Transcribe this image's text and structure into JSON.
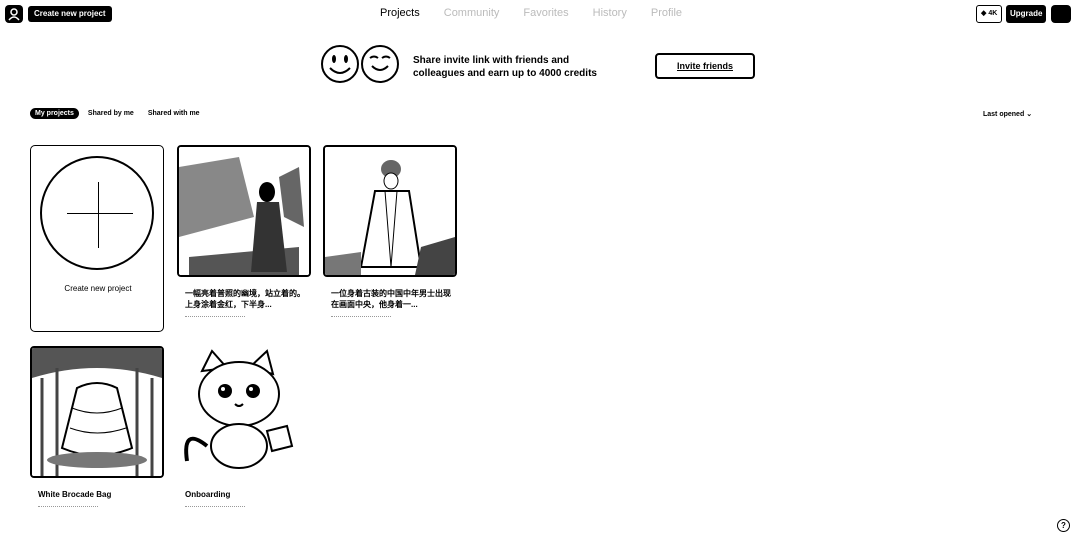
{
  "topbar": {
    "create_label": "Create new project",
    "nav": [
      {
        "label": "Projects",
        "active": true
      },
      {
        "label": "Community",
        "active": false
      },
      {
        "label": "Favorites",
        "active": false
      },
      {
        "label": "History",
        "active": false
      },
      {
        "label": "Profile",
        "active": false
      }
    ],
    "credits": "4K",
    "upgrade_label": "Upgrade"
  },
  "banner": {
    "line1": "Share invite link with friends and",
    "line2": "colleagues and earn up to 4000 credits",
    "button_label": "Invite friends"
  },
  "filters": {
    "tabs": [
      {
        "label": "My projects",
        "active": true
      },
      {
        "label": "Shared by me",
        "active": false
      },
      {
        "label": "Shared with me",
        "active": false
      }
    ],
    "sort_label": "Last opened",
    "sort_icon": "chevron-down-icon"
  },
  "new_project": {
    "label": "Create new project",
    "icon": "plus-icon"
  },
  "projects": [
    {
      "title": "一幅亮着普照的幽境，站立着的。上身涂着金红，下半身..."
    },
    {
      "title": "一位身着古装的中国中年男士出现在画面中央，他身着一..."
    },
    {
      "title": "White Brocade Bag"
    },
    {
      "title": "Onboarding"
    }
  ],
  "help_icon": "question-icon"
}
